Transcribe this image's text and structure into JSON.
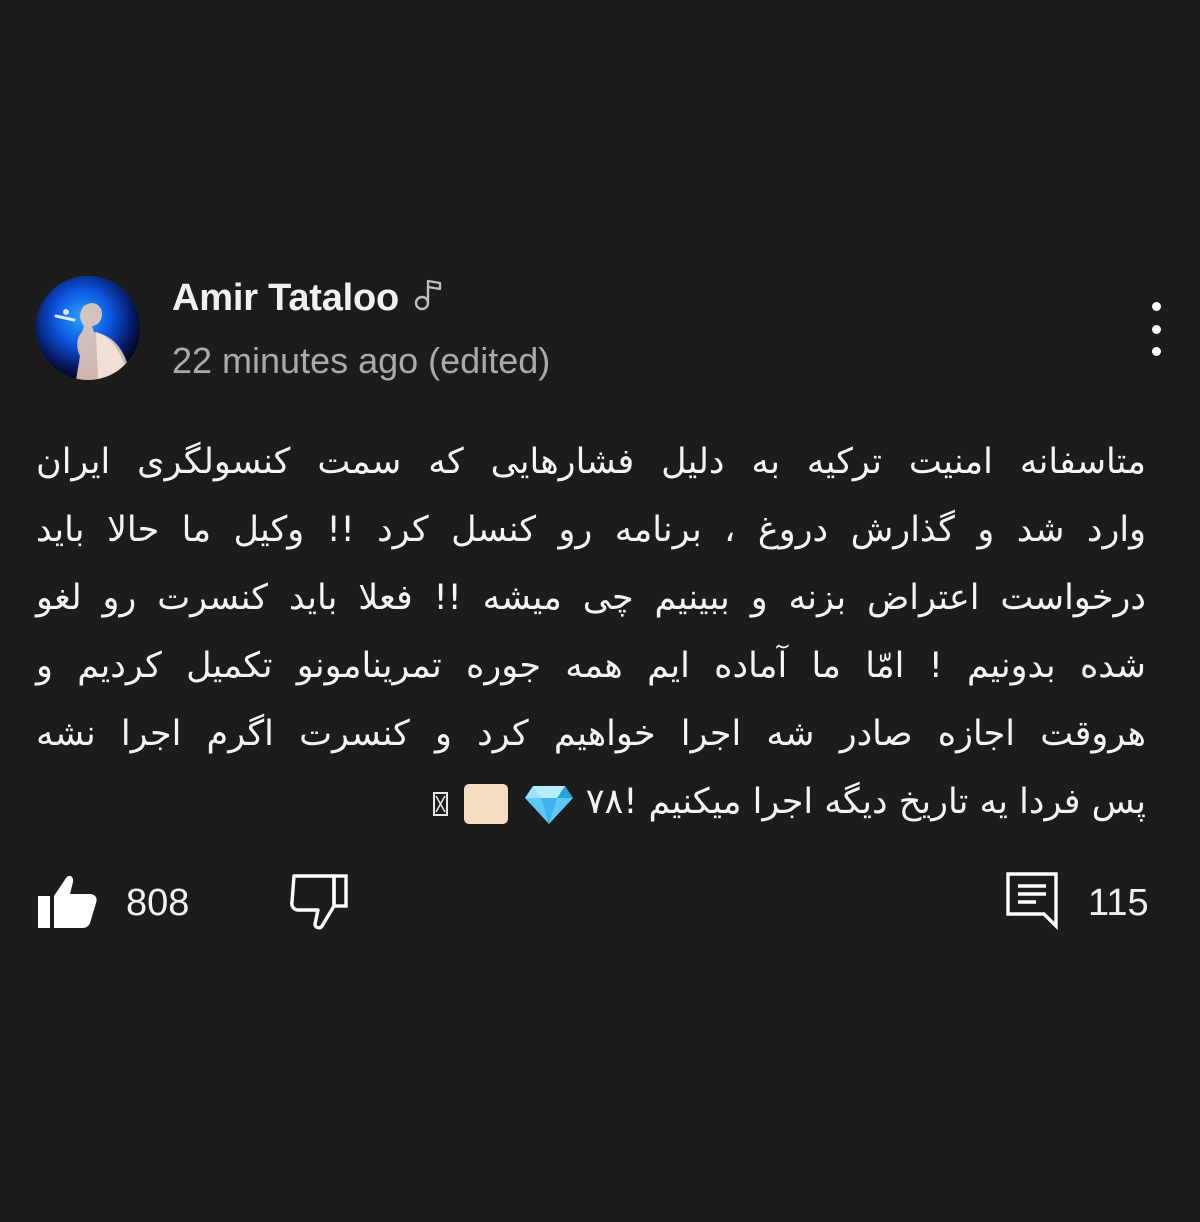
{
  "comment": {
    "author": "Amir Tataloo",
    "author_badge_icon": "music-note-icon",
    "timestamp": "22 minutes ago (edited)",
    "lines": [
      "متاسفانه امنیت ترکیه به دلیل فشارهایی که سمت کنسولگری ایران",
      "وارد شد و گذارش دروغ ، برنامه رو کنسل کرد !! وکیل ما حالا باید",
      "درخواست اعتراض بزنه و ببینیم چی میشه !! فعلا باید کنسرت رو لغو",
      "شده بدونیم ! امّا ما آماده ایم همه جوره تمرینامونو تکمیل کردیم و",
      "هروقت اجازه صادر شه اجرا خواهیم کرد و کنسرت اگرم اجرا نشه",
      "پس فردا یه تاریخ دیگه اجرا میکنیم !۷۸"
    ],
    "trailing_emojis": [
      "gem-stone-emoji",
      "skin-tone-square-emoji",
      "missing-glyph"
    ],
    "like_count": "808",
    "reply_count": "115"
  },
  "icons": {
    "more": "more-vertical-icon",
    "like": "thumbs-up-icon",
    "dislike": "thumbs-down-icon",
    "reply": "reply-icon"
  },
  "colors": {
    "background": "#1c1c1c",
    "text_primary": "#f1f1f1",
    "text_secondary": "#aaaaaa",
    "gem": "#5ec8f5",
    "skin_tone": "#f6dcc0"
  }
}
